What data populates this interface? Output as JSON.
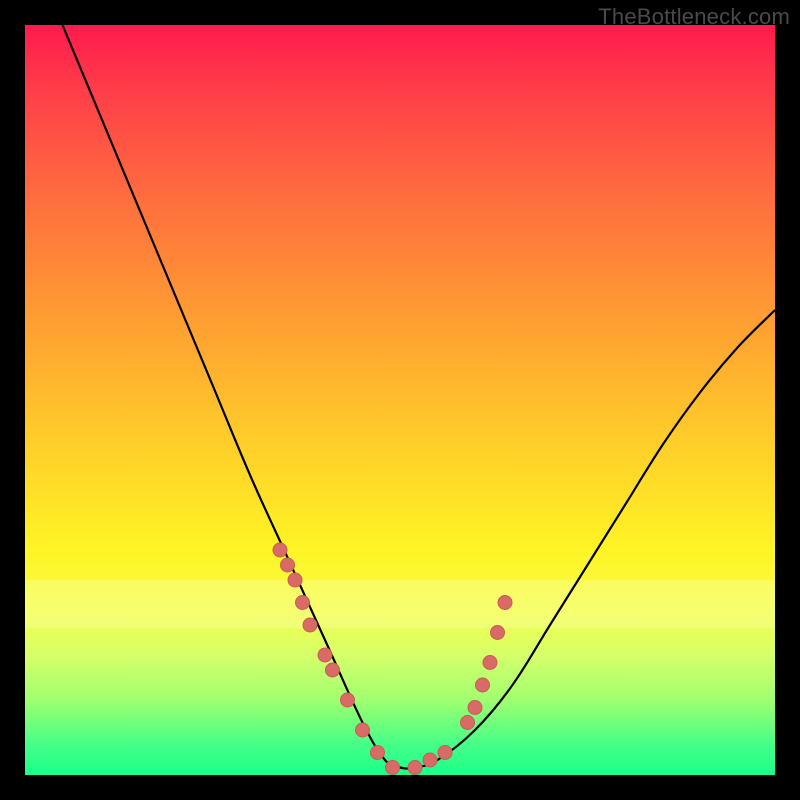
{
  "watermark": "TheBottleneck.com",
  "colors": {
    "curve_stroke": "#000000",
    "dot_fill": "#d96b66",
    "dot_stroke": "#c95a55"
  },
  "chart_data": {
    "type": "line",
    "title": "",
    "xlabel": "",
    "ylabel": "",
    "xlim": [
      0,
      100
    ],
    "ylim": [
      0,
      100
    ],
    "grid": false,
    "legend": false,
    "note": "V-shaped bottleneck curve; y is approximate relative height (0 = bottom/green, 100 = top/red). Values estimated from pixels.",
    "series": [
      {
        "name": "bottleneck-curve",
        "x": [
          5,
          10,
          15,
          20,
          25,
          30,
          35,
          40,
          45,
          48,
          50,
          52,
          55,
          60,
          65,
          70,
          75,
          80,
          85,
          90,
          95,
          100
        ],
        "y": [
          100,
          88,
          76,
          64,
          52,
          40,
          29,
          18,
          7,
          2,
          1,
          1,
          2,
          6,
          12,
          20,
          28,
          36,
          44,
          51,
          57,
          62
        ]
      }
    ],
    "markers": {
      "name": "highlight-dots",
      "note": "Salmon dots clustered near the valley on both arms; values estimated.",
      "x": [
        34,
        35,
        36,
        37,
        38,
        40,
        41,
        43,
        45,
        47,
        49,
        52,
        54,
        56,
        59,
        60,
        61,
        62,
        63,
        64
      ],
      "y": [
        30,
        28,
        26,
        23,
        20,
        16,
        14,
        10,
        6,
        3,
        1,
        1,
        2,
        3,
        7,
        9,
        12,
        15,
        19,
        23
      ]
    }
  }
}
